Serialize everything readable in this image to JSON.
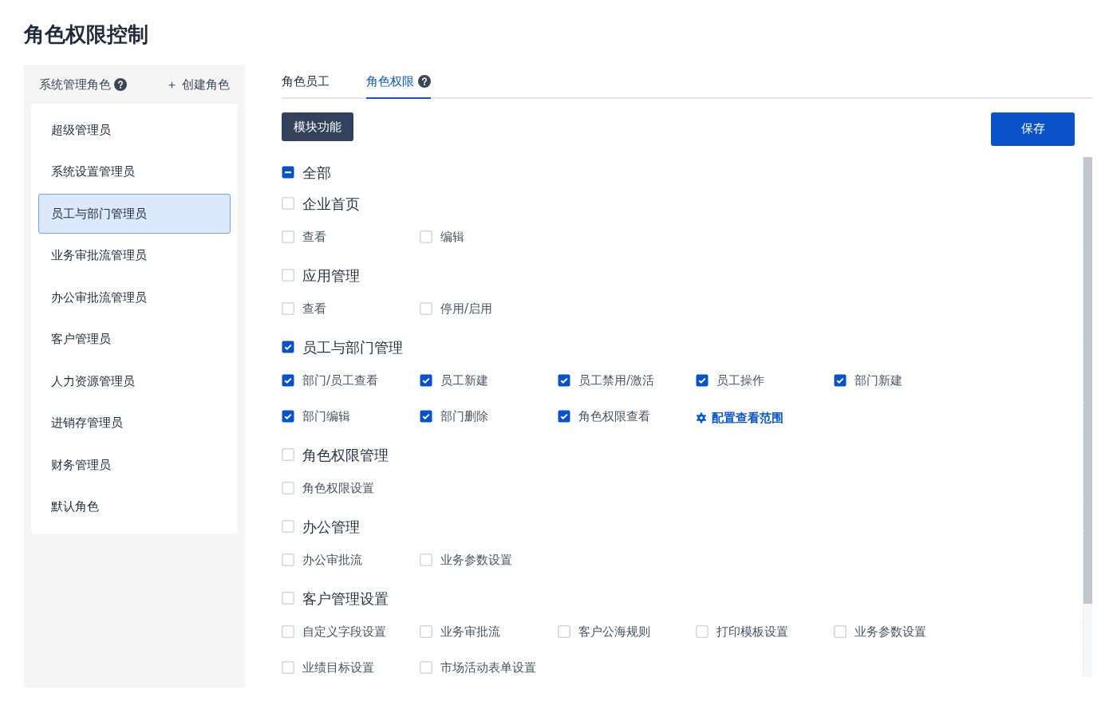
{
  "title": "角色权限控制",
  "sidebar": {
    "header": "系统管理角色",
    "create": "＋ 创建角色",
    "roles": [
      {
        "label": "超级管理员",
        "selected": false
      },
      {
        "label": "系统设置管理员",
        "selected": false
      },
      {
        "label": "员工与部门管理员",
        "selected": true
      },
      {
        "label": "业务审批流管理员",
        "selected": false
      },
      {
        "label": "办公审批流管理员",
        "selected": false
      },
      {
        "label": "客户管理员",
        "selected": false
      },
      {
        "label": "人力资源管理员",
        "selected": false
      },
      {
        "label": "进销存管理员",
        "selected": false
      },
      {
        "label": "财务管理员",
        "selected": false
      },
      {
        "label": "默认角色",
        "selected": false
      }
    ]
  },
  "tabs": [
    {
      "label": "角色员工",
      "selected": false,
      "help": false
    },
    {
      "label": "角色权限",
      "selected": true,
      "help": true
    }
  ],
  "module_button": "模块功能",
  "save_button": "保存",
  "all": {
    "label": "全部",
    "checked": false,
    "indeterminate": true
  },
  "modules": [
    {
      "label": "企业首页",
      "checked": false,
      "items": [
        {
          "kind": "checkbox",
          "label": "查看",
          "checked": false
        },
        {
          "kind": "checkbox",
          "label": "编辑",
          "checked": false
        }
      ]
    },
    {
      "label": "应用管理",
      "checked": false,
      "items": [
        {
          "kind": "checkbox",
          "label": "查看",
          "checked": false
        },
        {
          "kind": "checkbox",
          "label": "停用/启用",
          "checked": false
        }
      ]
    },
    {
      "label": "员工与部门管理",
      "checked": true,
      "items": [
        {
          "kind": "checkbox",
          "label": "部门/员工查看",
          "checked": true
        },
        {
          "kind": "checkbox",
          "label": "员工新建",
          "checked": true
        },
        {
          "kind": "checkbox",
          "label": "员工禁用/激活",
          "checked": true
        },
        {
          "kind": "checkbox",
          "label": "员工操作",
          "checked": true
        },
        {
          "kind": "checkbox",
          "label": "部门新建",
          "checked": true
        },
        {
          "kind": "checkbox",
          "label": "部门编辑",
          "checked": true
        },
        {
          "kind": "checkbox",
          "label": "部门删除",
          "checked": true
        },
        {
          "kind": "checkbox",
          "label": "角色权限查看",
          "checked": true
        },
        {
          "kind": "link",
          "label": "配置查看范围"
        }
      ]
    },
    {
      "label": "角色权限管理",
      "checked": false,
      "items": [
        {
          "kind": "checkbox",
          "label": "角色权限设置",
          "checked": false
        }
      ]
    },
    {
      "label": "办公管理",
      "checked": false,
      "items": [
        {
          "kind": "checkbox",
          "label": "办公审批流",
          "checked": false
        },
        {
          "kind": "checkbox",
          "label": "业务参数设置",
          "checked": false
        }
      ]
    },
    {
      "label": "客户管理设置",
      "checked": false,
      "items": [
        {
          "kind": "checkbox",
          "label": "自定义字段设置",
          "checked": false
        },
        {
          "kind": "checkbox",
          "label": "业务审批流",
          "checked": false
        },
        {
          "kind": "checkbox",
          "label": "客户公海规则",
          "checked": false
        },
        {
          "kind": "checkbox",
          "label": "打印模板设置",
          "checked": false
        },
        {
          "kind": "checkbox",
          "label": "业务参数设置",
          "checked": false
        },
        {
          "kind": "checkbox",
          "label": "业绩目标设置",
          "checked": false
        },
        {
          "kind": "checkbox",
          "label": "市场活动表单设置",
          "checked": false
        }
      ]
    }
  ]
}
